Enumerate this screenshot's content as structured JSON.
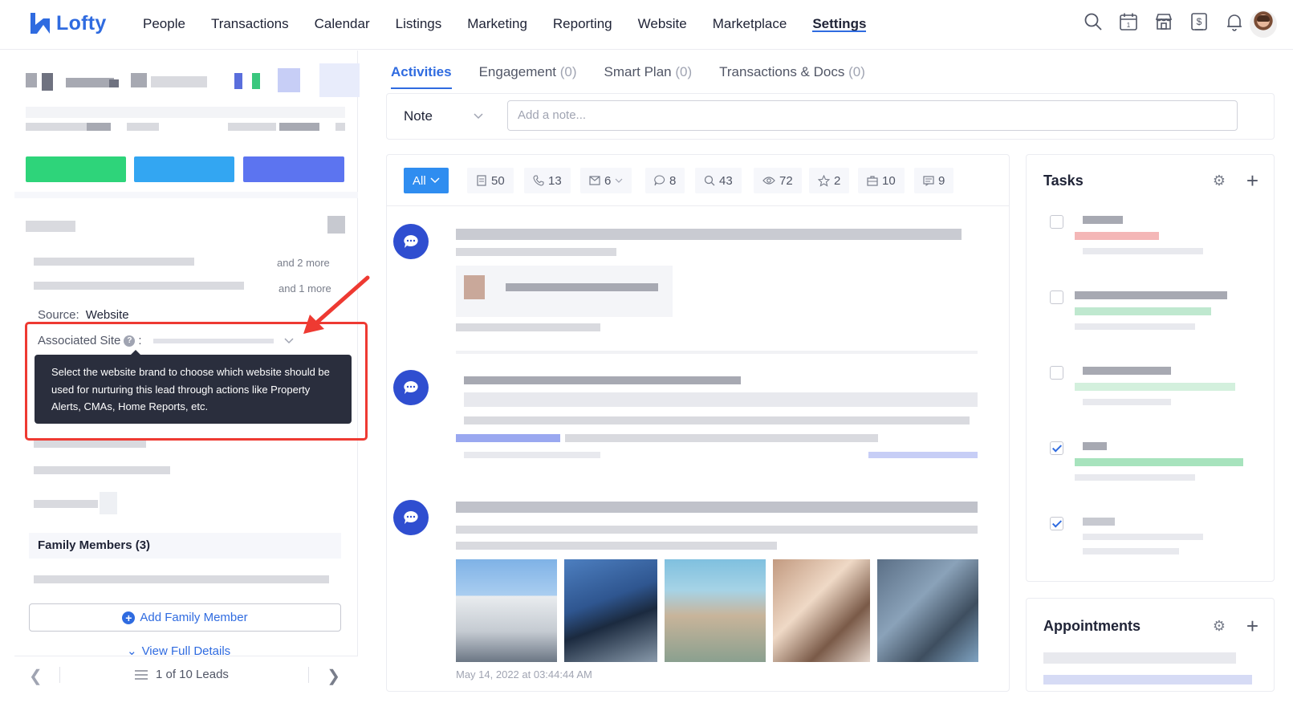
{
  "brand": {
    "name": "Lofty",
    "accent": "#2f6be0"
  },
  "nav": {
    "items": [
      "People",
      "Transactions",
      "Calendar",
      "Listings",
      "Marketing",
      "Reporting",
      "Website",
      "Marketplace",
      "Settings"
    ],
    "active": "Settings",
    "icons": [
      "search-icon",
      "calendar-icon",
      "store-icon",
      "dollar-icon",
      "bell-icon"
    ],
    "calendar_day": "1"
  },
  "lead": {
    "more_1": "and 2 more",
    "more_2": "and 1 more",
    "source_label": "Source:",
    "source_value": "Website",
    "associated_site_label": "Associated Site",
    "associated_site_sep": ":",
    "help_glyph": "?",
    "tooltip": "Select the website brand to choose which website should be used for nurturing this lead through actions like Property Alerts, CMAs, Home Reports, etc.",
    "family_title": "Family Members (3)",
    "add_family_label": "Add Family Member",
    "view_full_label": "View Full Details",
    "pager_text": "1 of 10 Leads"
  },
  "tabs": [
    {
      "label": "Activities",
      "count": ""
    },
    {
      "label": "Engagement",
      "count": "(0)"
    },
    {
      "label": "Smart Plan",
      "count": "(0)"
    },
    {
      "label": "Transactions & Docs",
      "count": "(0)"
    }
  ],
  "note": {
    "type_label": "Note",
    "placeholder": "Add a note..."
  },
  "filters": [
    {
      "icon": "all",
      "label": "All"
    },
    {
      "icon": "note-icon",
      "label": "50"
    },
    {
      "icon": "phone-icon",
      "label": "13"
    },
    {
      "icon": "mail-icon",
      "label": "6"
    },
    {
      "icon": "chat-icon",
      "label": "8"
    },
    {
      "icon": "search-icon",
      "label": "43"
    },
    {
      "icon": "eye-icon",
      "label": "72"
    },
    {
      "icon": "star-icon",
      "label": "2"
    },
    {
      "icon": "briefcase-icon",
      "label": "10"
    },
    {
      "icon": "message-icon",
      "label": "9"
    }
  ],
  "feed": {
    "timestamp": "May 14, 2022 at 03:44:44 AM"
  },
  "tasks": {
    "title": "Tasks",
    "checked": [
      false,
      false,
      false,
      true,
      true
    ]
  },
  "appointments": {
    "title": "Appointments"
  },
  "colors": {
    "annotation_red": "#ee3a32",
    "feed_icon": "#2f4ed0",
    "filter_active": "#2f8df0"
  }
}
